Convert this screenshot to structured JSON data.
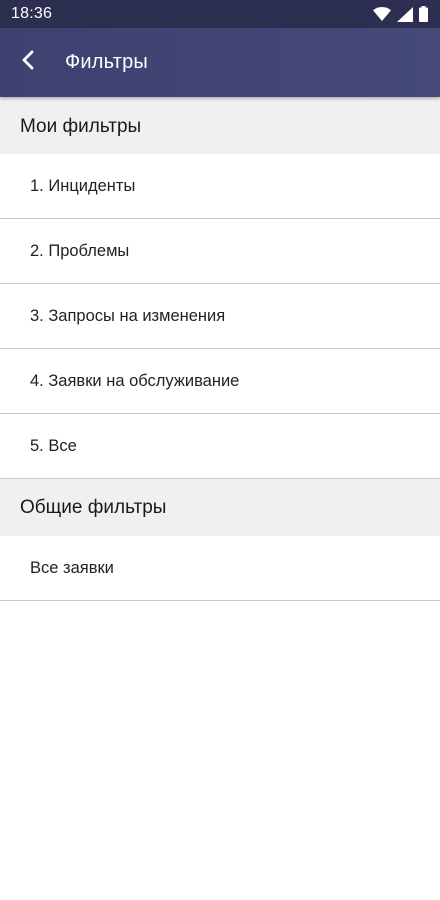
{
  "status_bar": {
    "time": "18:36",
    "icons": [
      "wifi-icon",
      "signal-icon",
      "battery-icon"
    ]
  },
  "app_bar": {
    "back_icon": "chevron-left-icon",
    "title": "Фильтры"
  },
  "sections": [
    {
      "title": "Мои фильтры",
      "items": [
        "1. Инциденты",
        "2. Проблемы",
        "3. Запросы на изменения",
        "4. Заявки на обслуживание",
        "5. Все"
      ]
    },
    {
      "title": "Общие фильтры",
      "items": [
        "Все заявки"
      ]
    }
  ],
  "colors": {
    "status_bar": "#2c2f4f",
    "app_bar": "#3d4170",
    "section_bg": "#f0f0f0",
    "divider": "#c8c8c8"
  }
}
